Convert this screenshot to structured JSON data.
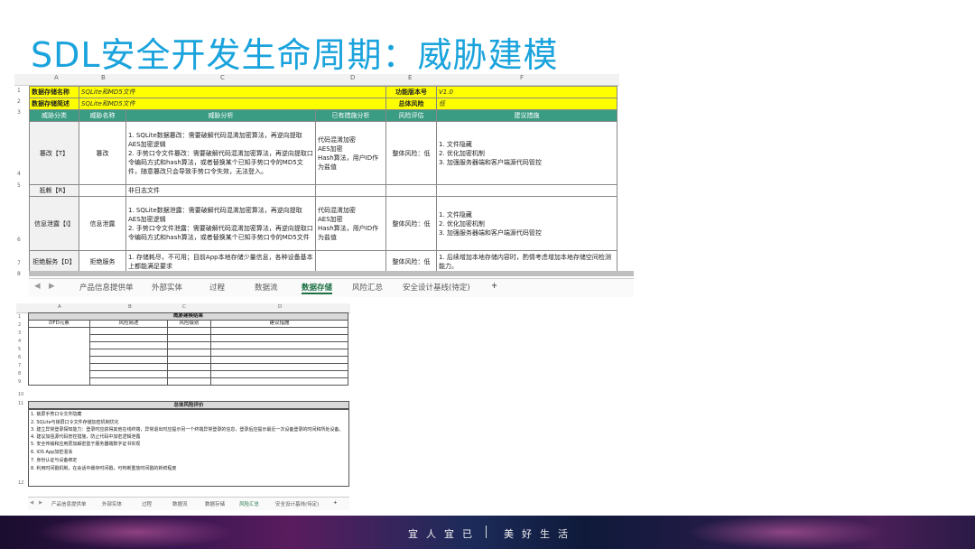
{
  "title": "SDL安全开发生命周期：威胁建模",
  "sheet1": {
    "col_letters": [
      "A",
      "B",
      "C",
      "D",
      "E",
      "F"
    ],
    "row_numbers": [
      "1",
      "2",
      "3",
      "4",
      "5",
      "6",
      "7",
      "8"
    ],
    "meta": {
      "store_name_label": "数据存储名称",
      "store_name_value": "SQLite和MD5文件",
      "store_desc_label": "数据存储简述",
      "store_desc_value": "SQLite和MD5文件",
      "version_label": "功能版本号",
      "version_value": "V1.0",
      "overall_label": "总体风险",
      "overall_value": "低"
    },
    "headers": [
      "威胁分类",
      "威胁名称",
      "威胁分析",
      "已有措施分析",
      "风险评估",
      "建议措施"
    ],
    "rows": [
      {
        "category": "篡改【T】",
        "name": "篡改",
        "analysis": "1. SQLite数据篡改：需要破解代码混淆加密算法，再逆向提取AES加密逻辑\n2. 手势口令文件篡改：需要破解代码混淆加密算法，再逆向提取口令编码方式和hash算法，或者替换某个已知手势口令的MD5文件，随意篡改只会导致手势口令失效，无法登入。",
        "measures": "代码混淆加密\nAES加密\nHash算法，用户ID作为盐值",
        "risk": "整体风险：低",
        "advice": "1. 文件隐藏\n2. 优化加密机制\n3. 加强服务器端和客户端源代码管控"
      },
      {
        "category": "抵赖【R】",
        "name": "",
        "analysis": "非日志文件",
        "measures": "",
        "risk": "",
        "advice": ""
      },
      {
        "category": "信息泄露【I】",
        "name": "信息泄露",
        "analysis": "1. SQLite数据泄露：需要破解代码混淆加密算法，再逆向提取AES加密逻辑\n2. 手势口令文件泄露：需要破解代码混淆加密算法，再逆向提取口令编码方式和hash算法，或者替换某个已知手势口令的MD5文件",
        "measures": "代码混淆加密\nAES加密\nHash算法，用户ID作为盐值",
        "risk": "整体风险：低",
        "advice": "1. 文件隐藏\n2. 优化加密机制\n3. 加强服务器端和客户端源代码管控"
      },
      {
        "category": "拒绝服务【D】",
        "name": "拒绝服务",
        "analysis": "1. 存储耗尽，不可用；目前App本地存储少量信息，各种设备基本上都能满足要求",
        "measures": "",
        "risk": "整体风险：低",
        "advice": "1. 后续增加本地存储内容时，酌情考虑增加本地存储空间检测能力。"
      }
    ],
    "tabs": [
      "产品信息提供单",
      "外部实体",
      "过程",
      "数据流",
      "数据存储",
      "风险汇总",
      "安全设计基线(待定)",
      "+"
    ],
    "active_tab": "数据存储"
  },
  "sheet2": {
    "col_letters": [
      "A",
      "B",
      "C",
      "D"
    ],
    "row_numbers": [
      "1",
      "2",
      "3",
      "4",
      "5",
      "6",
      "7",
      "8",
      "9",
      "10",
      "11",
      "12"
    ],
    "table_title": "威胁建模结果",
    "headers": [
      "DFD元素",
      "风险简述",
      "风险级别",
      "建议措施"
    ],
    "risk_title": "总体风险评价",
    "risk_items": [
      "1. 锁屏手势口令文件隐藏",
      "2. SQLite与锁屏口令文件存储加密机制优化",
      "3. 建立异常登录探知能力：登录时应获得其他在线终端，异常退出时应提示另一个终端异常登录的信息，登录后应提示最近一次设备登录的时间和所处设备。",
      "4. 建议加强源代码管控措施，防止代码中加密逻辑泄露",
      "5. 安全传输和应用层加解密基于服务器端数字证书实现",
      "6. IOS App加密混淆",
      "7. 身份认证与设备绑定",
      "8. 利用时间戳机制，在会话中缓存时间戳，可判断重放时间戳的新鲜程度"
    ],
    "tabs": [
      "产品信息提供单",
      "外部实体",
      "过程",
      "数据流",
      "数据存储",
      "风险汇总",
      "安全设计基线(待定)",
      "+"
    ],
    "active_tab": "风险汇总"
  },
  "footer": {
    "slogan_left": "宜人宜已",
    "slogan_right": "美好生活"
  }
}
